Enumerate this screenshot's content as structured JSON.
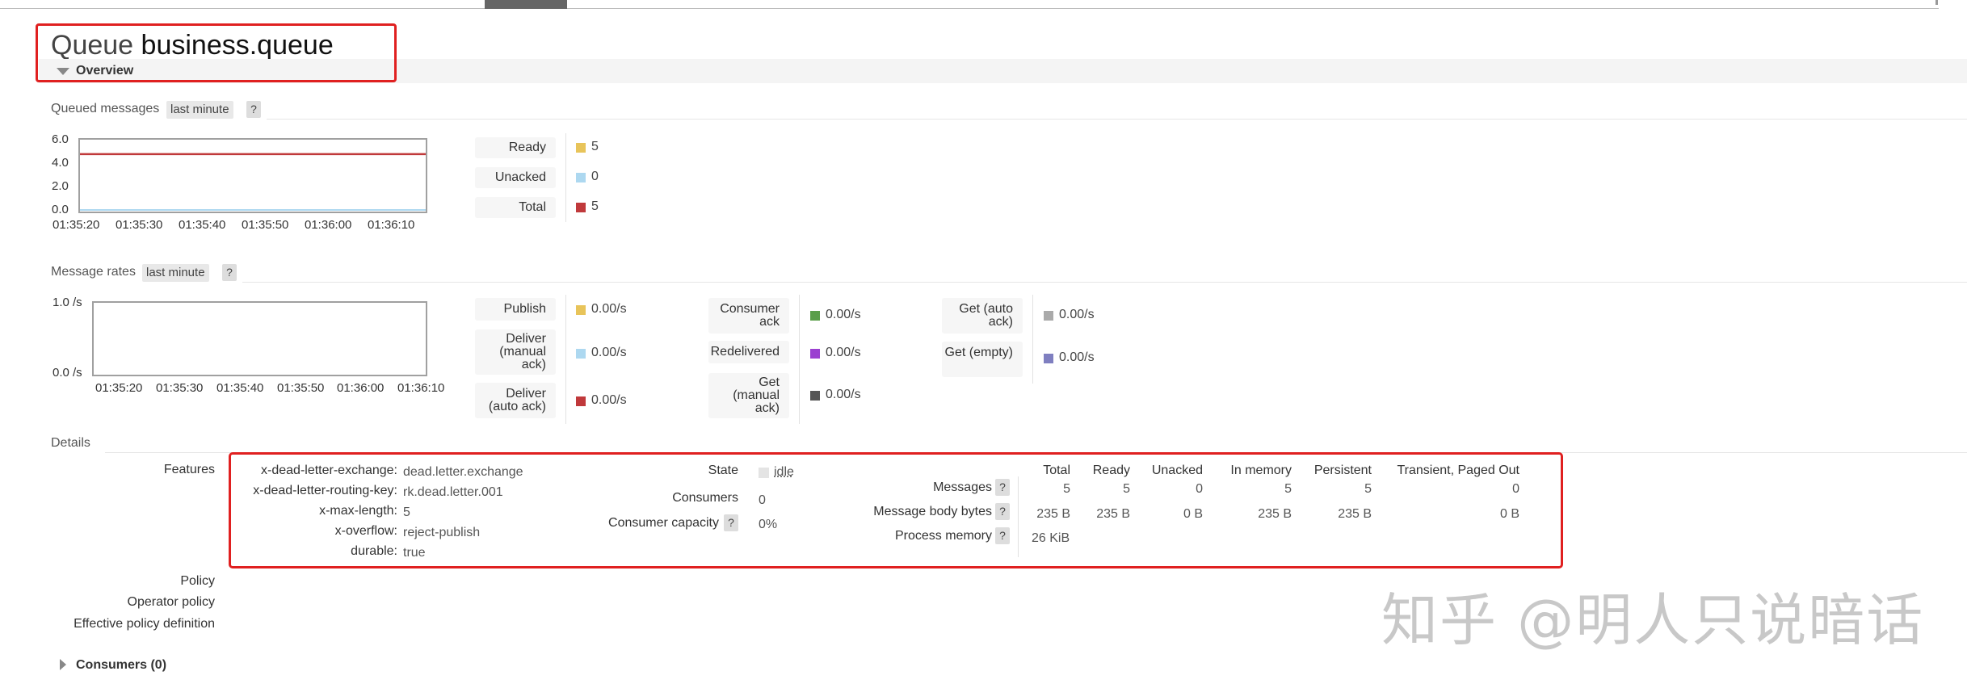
{
  "header": {
    "kind": "Queue",
    "name": "business.queue"
  },
  "overview": {
    "label": "Overview"
  },
  "queued_messages": {
    "label": "Queued messages",
    "range": "last minute",
    "help": "?",
    "y_ticks": [
      "6.0",
      "4.0",
      "2.0",
      "0.0"
    ],
    "x_ticks": [
      "01:35:20",
      "01:35:30",
      "01:35:40",
      "01:35:50",
      "01:36:00",
      "01:36:10"
    ],
    "legend": [
      {
        "label": "Ready",
        "value": "5",
        "color": "#e8c45a"
      },
      {
        "label": "Unacked",
        "value": "0",
        "color": "#add8f0"
      },
      {
        "label": "Total",
        "value": "5",
        "color": "#c0393b"
      }
    ]
  },
  "message_rates": {
    "label": "Message rates",
    "range": "last minute",
    "help": "?",
    "y_ticks": [
      "1.0 /s",
      "0.0 /s"
    ],
    "x_ticks": [
      "01:35:20",
      "01:35:30",
      "01:35:40",
      "01:35:50",
      "01:36:00",
      "01:36:10"
    ],
    "col1": [
      {
        "label": "Publish",
        "value": "0.00/s",
        "color": "#e8c45a"
      },
      {
        "label": "Deliver (manual ack)",
        "value": "0.00/s",
        "color": "#add8f0"
      },
      {
        "label": "Deliver (auto ack)",
        "value": "0.00/s",
        "color": "#c0393b"
      }
    ],
    "col2": [
      {
        "label": "Consumer ack",
        "value": "0.00/s",
        "color": "#5a9e4a"
      },
      {
        "label": "Redelivered",
        "value": "0.00/s",
        "color": "#9b40d0"
      },
      {
        "label": "Get (manual ack)",
        "value": "0.00/s",
        "color": "#555555"
      }
    ],
    "col3": [
      {
        "label": "Get (auto ack)",
        "value": "0.00/s",
        "color": "#aaaaaa"
      },
      {
        "label": "Get (empty)",
        "value": "0.00/s",
        "color": "#7f7fc0"
      }
    ]
  },
  "details": {
    "label": "Details",
    "features_label": "Features",
    "features": [
      {
        "key": "x-dead-letter-exchange:",
        "value": "dead.letter.exchange"
      },
      {
        "key": "x-dead-letter-routing-key:",
        "value": "rk.dead.letter.001"
      },
      {
        "key": "x-max-length:",
        "value": "5"
      },
      {
        "key": "x-overflow:",
        "value": "reject-publish"
      },
      {
        "key": "durable:",
        "value": "true"
      }
    ],
    "state_label": "State",
    "state_value": "idle",
    "consumers_label": "Consumers",
    "consumers_value": "0",
    "consumer_capacity_label": "Consumer capacity",
    "consumer_capacity_help": "?",
    "consumer_capacity_value": "0%",
    "table": {
      "columns": [
        "Total",
        "Ready",
        "Unacked",
        "In memory",
        "Persistent",
        "Transient, Paged Out"
      ],
      "rows": [
        {
          "label": "Messages",
          "help": "?",
          "values": [
            "5",
            "5",
            "0",
            "5",
            "5",
            "0"
          ]
        },
        {
          "label": "Message body bytes",
          "help": "?",
          "values": [
            "235 B",
            "235 B",
            "0 B",
            "235 B",
            "235 B",
            "0 B"
          ]
        },
        {
          "label": "Process memory",
          "help": "?",
          "values": [
            "26 KiB"
          ]
        }
      ]
    },
    "policy_label": "Policy",
    "operator_policy_label": "Operator policy",
    "effective_policy_label": "Effective policy definition"
  },
  "consumers_section": {
    "label": "Consumers (0)"
  },
  "watermark": "知乎 @明人只说暗话",
  "chart_data": [
    {
      "type": "line",
      "ylim": [
        0,
        6
      ],
      "y_ticks": [
        "6.0",
        "4.0",
        "2.0",
        "0.0"
      ],
      "x_ticks": [
        "01:35:20",
        "01:35:30",
        "01:35:40",
        "01:35:50",
        "01:36:00",
        "01:36:10"
      ],
      "series": [
        {
          "name": "Ready",
          "values": [
            5,
            5,
            5,
            5,
            5,
            5
          ]
        },
        {
          "name": "Unacked",
          "values": [
            0,
            0,
            0,
            0,
            0,
            0
          ]
        },
        {
          "name": "Total",
          "values": [
            5,
            5,
            5,
            5,
            5,
            5
          ]
        }
      ]
    },
    {
      "type": "line",
      "ylim": [
        0,
        1
      ],
      "y_ticks": [
        "1.0 /s",
        "0.0 /s"
      ],
      "x_ticks": [
        "01:35:20",
        "01:35:30",
        "01:35:40",
        "01:35:50",
        "01:36:00",
        "01:36:10"
      ],
      "series": []
    }
  ]
}
